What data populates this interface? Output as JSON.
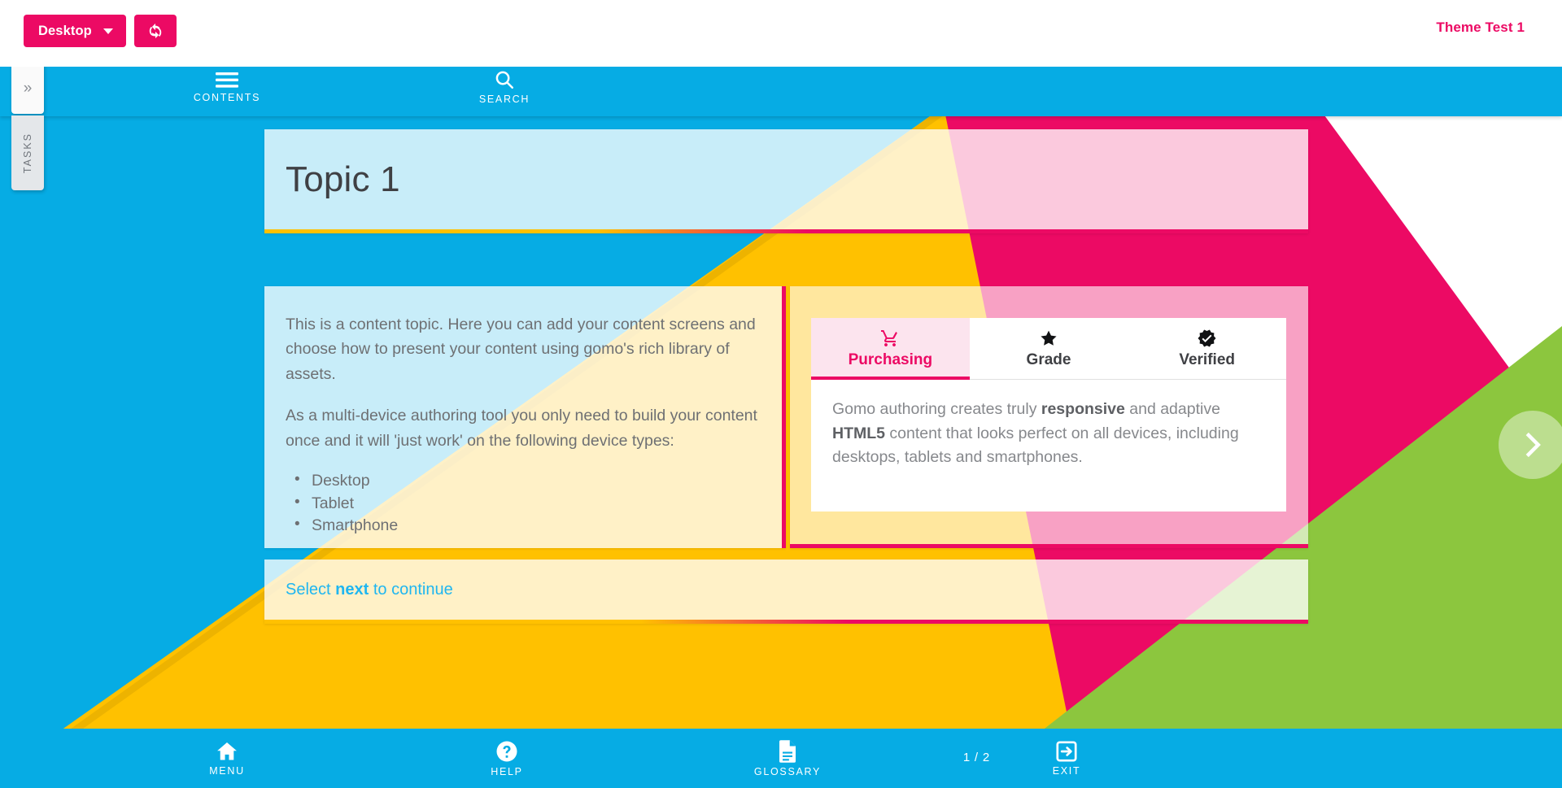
{
  "toolbar": {
    "device_label": "Desktop",
    "device_icon": "chevron-down-icon",
    "refresh_icon": "refresh-icon",
    "theme_title": "Theme Test 1"
  },
  "sidetabs": {
    "collapse_glyph": "»",
    "tasks_label": "TASKS"
  },
  "coursenav": {
    "items": [
      {
        "label": "CONTENTS",
        "icon": "hamburger-icon"
      },
      {
        "label": "SEARCH",
        "icon": "search-icon"
      }
    ]
  },
  "main": {
    "page_title": "Topic 1",
    "left_card": {
      "paragraph1": "This is a content topic. Here you can add your content screens and choose how to present your content using gomo's rich library of assets.",
      "paragraph2": "As a multi-device authoring tool you only need to build your content once and it will 'just work' on the following device types:",
      "device_list": [
        "Desktop",
        "Tablet",
        "Smartphone"
      ]
    },
    "right_card": {
      "tabs": [
        {
          "label": "Purchasing",
          "icon": "shopping-cart-icon",
          "active": true
        },
        {
          "label": "Grade",
          "icon": "star-icon",
          "active": false
        },
        {
          "label": "Verified",
          "icon": "verified-badge-icon",
          "active": false
        }
      ],
      "panel": {
        "text_part1": "Gomo authoring creates truly ",
        "bold1": "responsive",
        "text_part2": " and adaptive ",
        "bold2": "HTML5",
        "text_part3": " content that looks perfect on all devices, including desktops, tablets and smartphones."
      }
    },
    "footer_card": {
      "text_before": "Select ",
      "text_bold": "next",
      "text_after": " to continue"
    },
    "next_button_icon": "chevron-right-icon"
  },
  "bottomnav": {
    "items": [
      {
        "label": "MENU",
        "icon": "home-icon"
      },
      {
        "label": "HELP",
        "icon": "question-circle-icon"
      },
      {
        "label": "GLOSSARY",
        "icon": "document-icon"
      },
      {
        "label": "EXIT",
        "icon": "exit-arrow-icon"
      }
    ],
    "page_counter": "1 / 2"
  },
  "colors": {
    "accent_pink": "#ec0a64",
    "nav_blue": "#06ace4",
    "bg_yellow": "#ffc100",
    "bg_green": "#8cc63e",
    "bg_pink": "#ec0a64",
    "link_blue": "#1fb6f0"
  }
}
